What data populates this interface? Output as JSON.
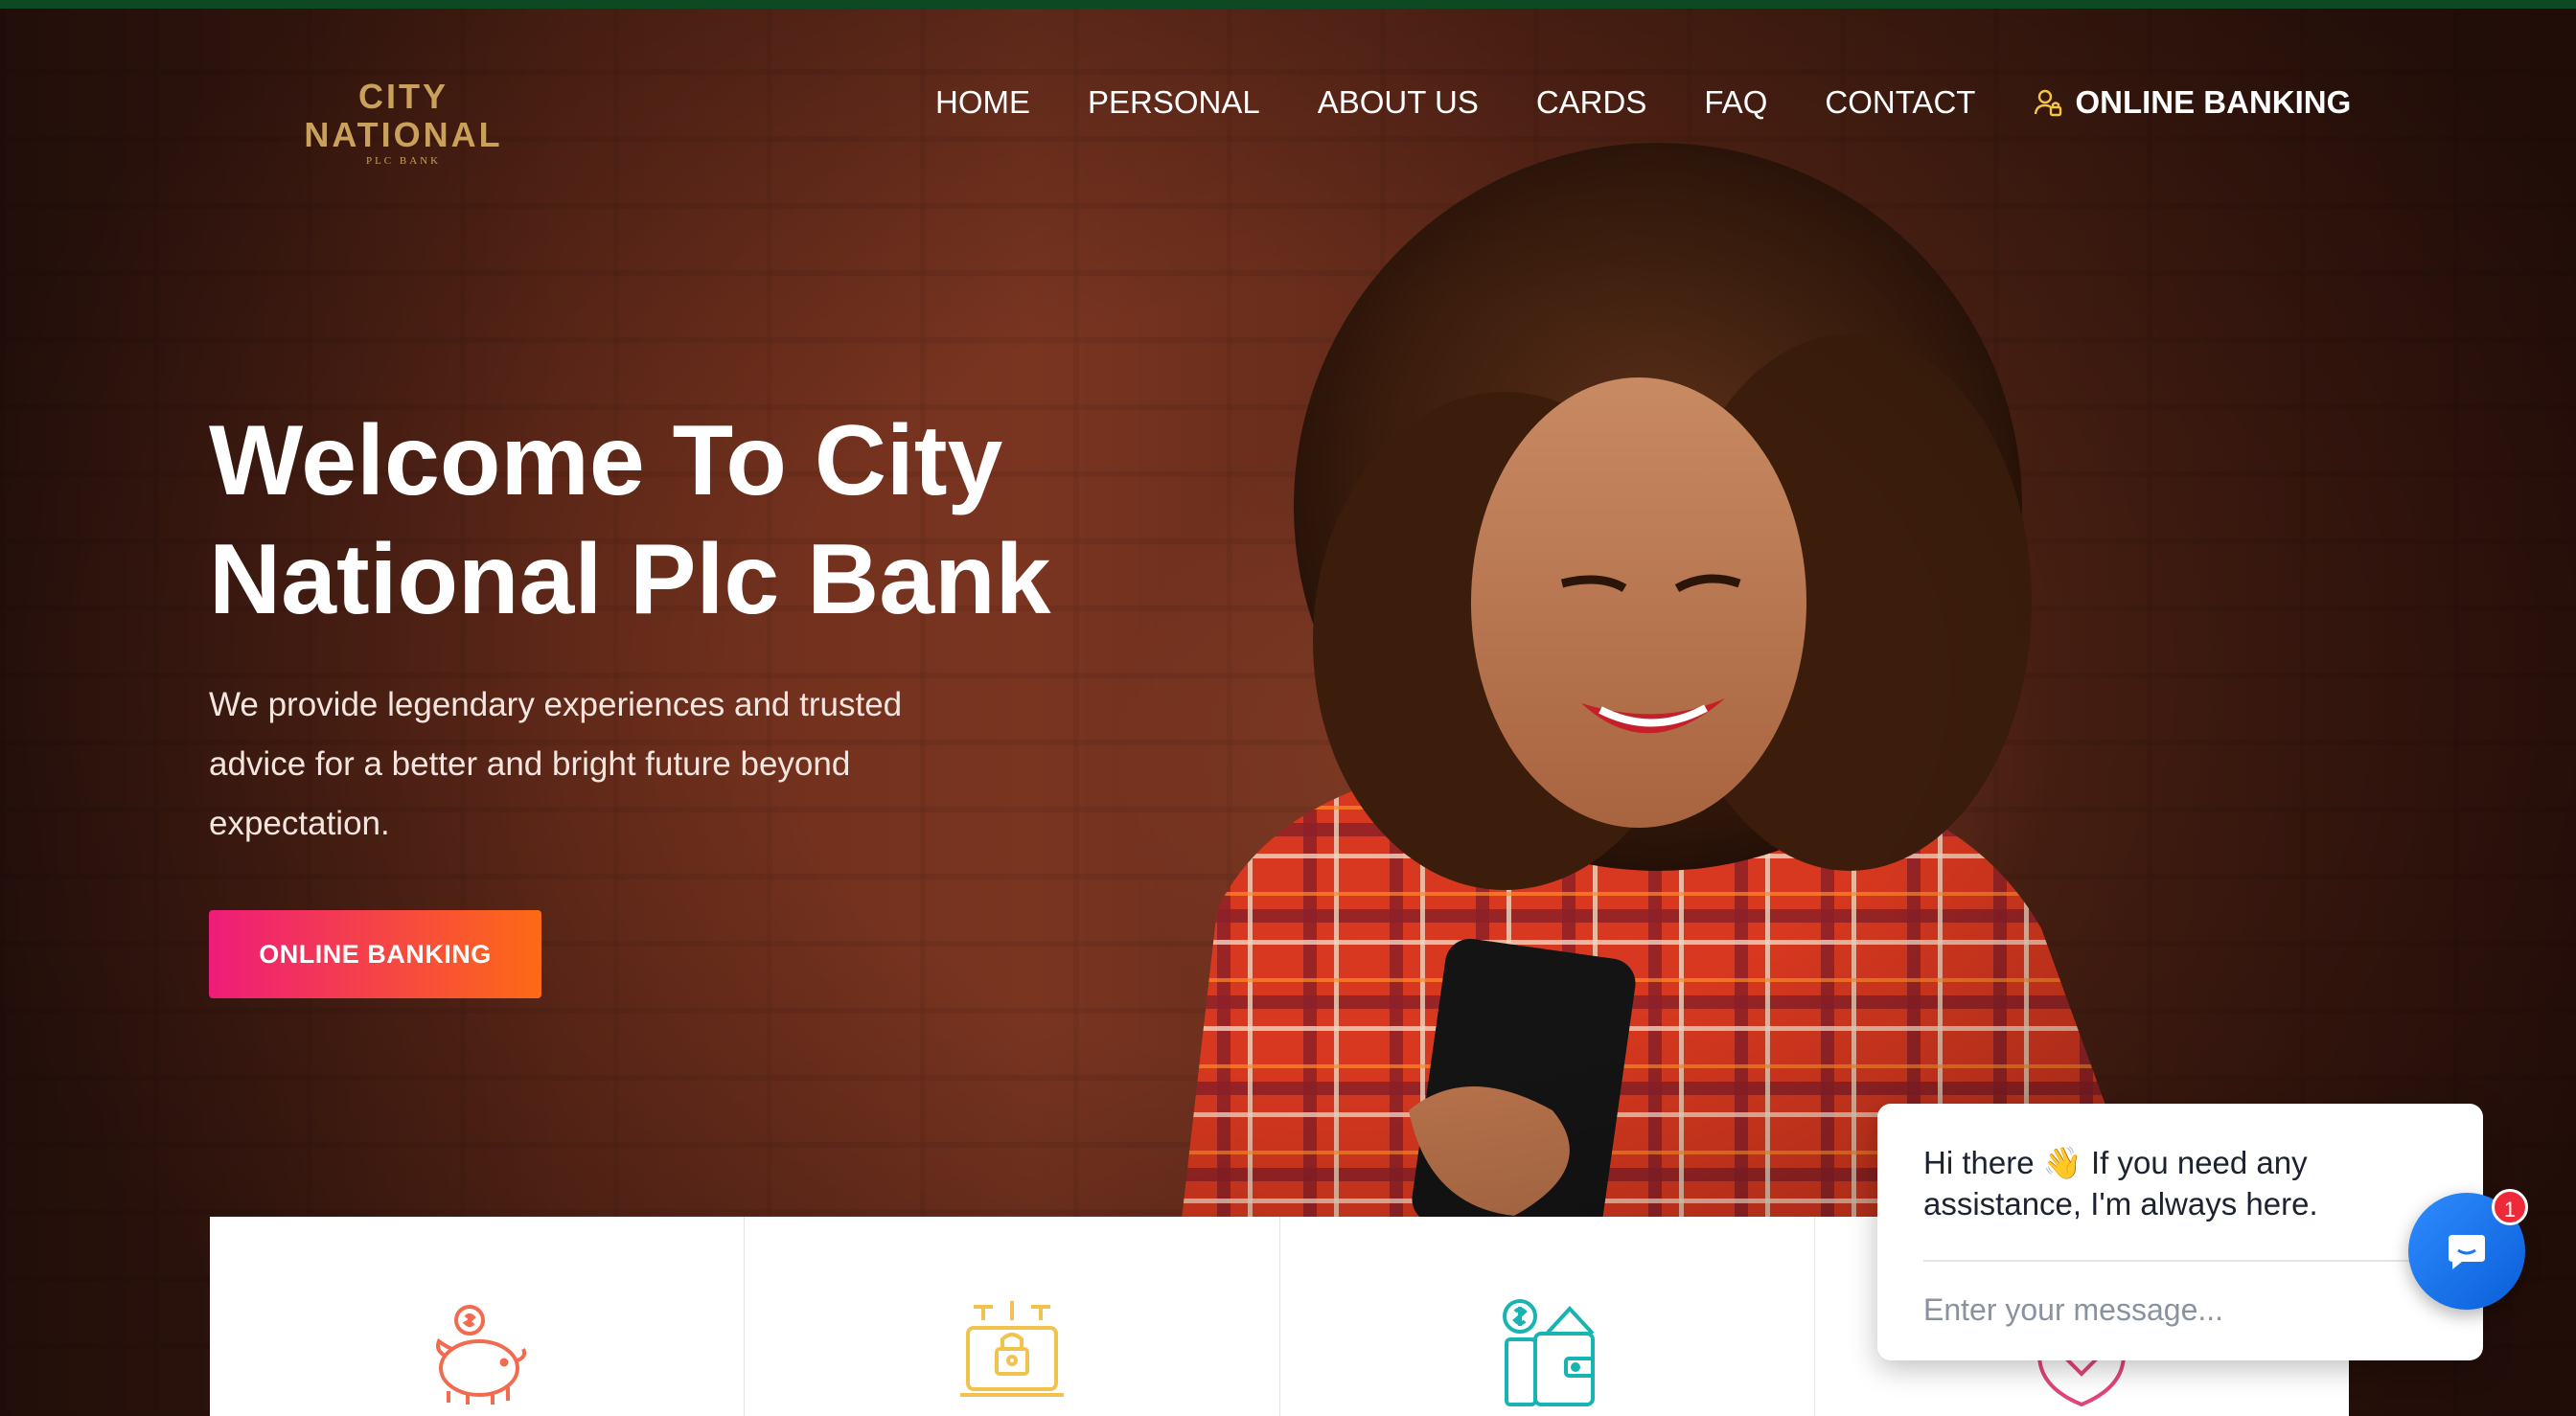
{
  "brand": {
    "name": "CITY NATIONAL",
    "tagline": "PLC BANK"
  },
  "nav": {
    "items": [
      {
        "label": "HOME"
      },
      {
        "label": "PERSONAL"
      },
      {
        "label": "ABOUT US"
      },
      {
        "label": "CARDS"
      },
      {
        "label": "FAQ"
      },
      {
        "label": "CONTACT"
      }
    ],
    "online_banking": {
      "label": "ONLINE BANKING",
      "icon": "user-lock-icon"
    }
  },
  "hero": {
    "title_line1": "Welcome To City",
    "title_line2": "National Plc Bank",
    "subtitle": "We provide legendary experiences and trusted advice for a better and bright future beyond expectation.",
    "cta_label": "ONLINE BANKING"
  },
  "features": [
    {
      "icon": "piggy-bank-icon",
      "color": "#f26b4f"
    },
    {
      "icon": "secure-laptop-icon",
      "color": "#f2c24f"
    },
    {
      "icon": "wallet-money-icon",
      "color": "#18b3b3"
    },
    {
      "icon": "shield-heart-icon",
      "color": "#e0457a"
    }
  ],
  "chat": {
    "message": "Hi there 👋 If you need any assistance, I'm always here.",
    "input_placeholder": "Enter your message...",
    "unread_count": "1"
  },
  "colors": {
    "topbar": "#0d4a23",
    "logo_gold": "#c9a15a",
    "cta_start": "#ee1c7a",
    "cta_end": "#fd6a15",
    "chat_button": "#1f74f0",
    "badge": "#ee2a3a"
  }
}
